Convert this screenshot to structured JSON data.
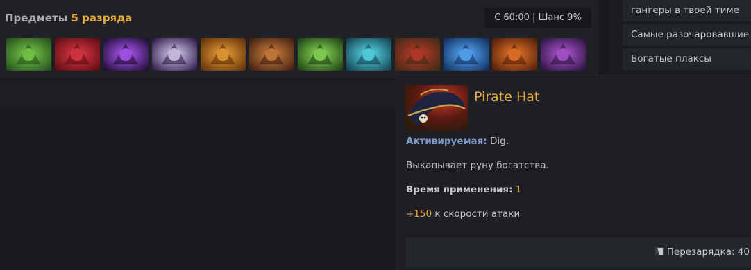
{
  "items_panel": {
    "title_prefix": "Предметы",
    "title_tier": "5 разряда",
    "chance_text": "С 60:00 | Шанс 9%",
    "items": [
      {
        "name": "green-boot-item-icon",
        "colors": [
          "#1f4a1a",
          "#7ed04b"
        ]
      },
      {
        "name": "red-claw-item-icon",
        "colors": [
          "#5a0a10",
          "#e23a48"
        ]
      },
      {
        "name": "purple-spike-item-icon",
        "colors": [
          "#180a2c",
          "#b55bff"
        ]
      },
      {
        "name": "purple-mirror-item-icon",
        "colors": [
          "#2a0f44",
          "#d9d4f0"
        ]
      },
      {
        "name": "gold-gem-amulet-item-icon",
        "colors": [
          "#5a2a06",
          "#f0a43a"
        ]
      },
      {
        "name": "crossbow-item-icon",
        "colors": [
          "#3a1a10",
          "#d3843c"
        ]
      },
      {
        "name": "green-cube-item-icon",
        "colors": [
          "#173a10",
          "#8fe05a"
        ]
      },
      {
        "name": "cyan-axe-item-icon",
        "colors": [
          "#0f3a4a",
          "#5ae0f0"
        ]
      },
      {
        "name": "pirate-hat-item-icon",
        "colors": [
          "#3a2a14",
          "#c43a2a"
        ]
      },
      {
        "name": "blue-orb-item-icon",
        "colors": [
          "#0e2a5a",
          "#5ab0ff"
        ]
      },
      {
        "name": "lava-shield-item-icon",
        "colors": [
          "#4a1a08",
          "#f07a2a"
        ]
      },
      {
        "name": "arcane-tome-item-icon",
        "colors": [
          "#24103a",
          "#b65ad8"
        ]
      }
    ]
  },
  "sidebar": {
    "items": [
      {
        "label": "гангеры в твоей тиме"
      },
      {
        "label": "Самые разочаровавшие"
      },
      {
        "label": "Богатые плаксы"
      }
    ]
  },
  "tooltip": {
    "title": "Pirate Hat",
    "active_label": "Активируемая:",
    "active_value": "Dig.",
    "description": "Выкапывает руну богатства.",
    "cast_label": "Время применения:",
    "cast_value": "1",
    "bonus_value": "+150",
    "bonus_text": "к скорости атаки",
    "cooldown_text": "Перезарядка: 40"
  },
  "colors": {
    "accent": "#e8a83e",
    "active_label": "#7f99c9",
    "background": "#181a1e"
  }
}
